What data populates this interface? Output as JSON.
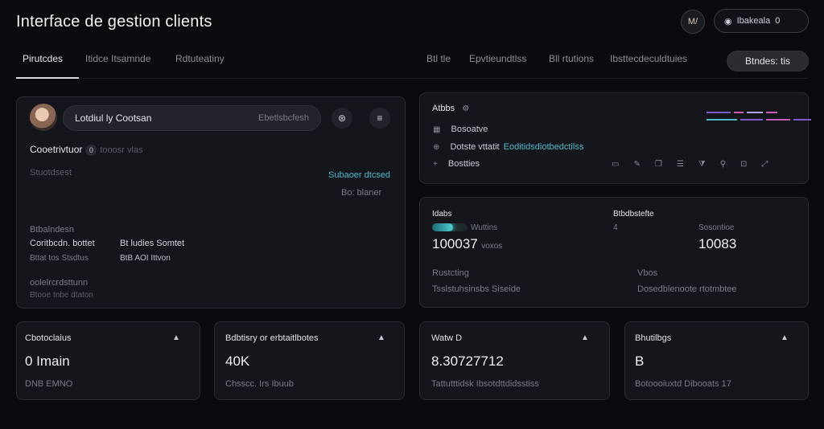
{
  "header": {
    "title": "Interface de gestion clients",
    "avatar_initials": "M/",
    "account_label": "Ibakeala",
    "account_extra": "0"
  },
  "tabs": [
    {
      "label": "Pirutcdes",
      "active": true
    },
    {
      "label": "Itidce Itsamnde",
      "active": false
    },
    {
      "label": "Rdtuteatiny",
      "active": false
    }
  ],
  "topnav": {
    "items": [
      "Btl tle",
      "Epvtieundtlss",
      "Bll rtutions",
      "Ibsttecdeculdtuies"
    ],
    "button_label": "Btndes: tis"
  },
  "profile_card": {
    "search_value": "Lotdiul ly Cootsan",
    "search_hint": "Ebetlsbcfesh",
    "section_title": "Cooetrivtuor",
    "section_badge": "0",
    "section_suffix": "tooosr vlas",
    "subtitle": "Stuotdsest",
    "link_primary": "Subaoer dtcsed",
    "link_secondary": "Bo: blaner",
    "detail_heading": "Btbalndesn",
    "detail_col1": "Coritbcdn. bottet",
    "detail_col2": "Bt ludies Somtet",
    "detail_col1_sub": "Bttat tos Stsdtus",
    "detail_col2_sub": "BtB AOI Ittvon",
    "footer_heading": "oolelrcrdsttunn",
    "footer_sub": "Btooe tnbe dtaton"
  },
  "activity_card": {
    "title": "Atbbs",
    "title_icon": "settings-icon",
    "rows": [
      {
        "icon": "grid-icon",
        "label": "Bosoatve",
        "extra": ""
      },
      {
        "icon": "link-icon",
        "label": "Dotste vttatit",
        "extra": "Eoditidsdiotbedctilss"
      },
      {
        "icon": "plus-icon",
        "label": "Bostties",
        "extra": ""
      }
    ],
    "legend": {
      "colors": [
        "#7a5cc8",
        "#c45cb8",
        "#4fb9c8",
        "#b9a6e8"
      ]
    }
  },
  "stats_card": {
    "left_title": "Idabs",
    "left_subtitle": "Wuttins",
    "progress": 0.6,
    "left_value": "100037",
    "left_value_suffix": "voxos",
    "left_row1": "Rustcting",
    "left_row2": "Tsslstuhsinsbs Siseide",
    "right_title": "Btbdbstefte",
    "right_indicator": "4",
    "right_subtitle": "Sosontioe",
    "right_value": "10083",
    "right_row1": "Vbos",
    "right_row2": "Dosedblenoote rtotmbtee"
  },
  "kpis": [
    {
      "title": "Cbotoclaius",
      "value": "0 Imain",
      "sub": "DNB EMNO"
    },
    {
      "title": "Bdbtisry or erbtaitlbotes",
      "value": "40K",
      "sub": "Chsscc. Irs Ibuub"
    },
    {
      "title": "Watw D",
      "value": "8.30727712",
      "sub": "Tattutttidsk Ibsotdttdidsstiss"
    },
    {
      "title": "Bhutilbgs",
      "value": "B",
      "sub": "Botoooiuxtd Dibooats 17"
    }
  ]
}
